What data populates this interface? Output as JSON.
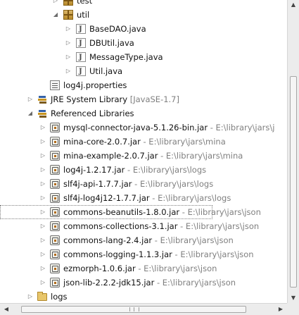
{
  "tree": {
    "test_pkg": "test",
    "util_pkg": "util",
    "files": [
      "BaseDAO.java",
      "DBUtil.java",
      "MessageType.java",
      "Util.java"
    ],
    "log4j": "log4j.properties",
    "jre": {
      "label": "JRE System Library",
      "version": "[JavaSE-1.7]"
    },
    "reflibs": "Referenced Libraries",
    "jars": [
      {
        "name": "mysql-connector-java-5.1.26-bin.jar",
        "path": " - E:\\library\\jars\\j"
      },
      {
        "name": "mina-core-2.0.7.jar",
        "path": " - E:\\library\\jars\\mina"
      },
      {
        "name": "mina-example-2.0.7.jar",
        "path": " - E:\\library\\jars\\mina"
      },
      {
        "name": "log4j-1.2.17.jar",
        "path": " - E:\\library\\jars\\logs"
      },
      {
        "name": "slf4j-api-1.7.7.jar",
        "path": " - E:\\library\\jars\\logs"
      },
      {
        "name": "slf4j-log4j12-1.7.7.jar",
        "path": " - E:\\library\\jars\\logs"
      },
      {
        "name": "commons-beanutils-1.8.0.jar",
        "path": " - E:\\library\\jars\\json"
      },
      {
        "name": "commons-collections-3.1.jar",
        "path": " - E:\\library\\jars\\json"
      },
      {
        "name": "commons-lang-2.4.jar",
        "path": " - E:\\library\\jars\\json"
      },
      {
        "name": "commons-logging-1.1.3.jar",
        "path": " - E:\\library\\jars\\json"
      },
      {
        "name": "ezmorph-1.0.6.jar",
        "path": " - E:\\library\\jars\\json"
      },
      {
        "name": "json-lib-2.2.2-jdk15.jar",
        "path": " - E:\\library\\jars\\json"
      }
    ],
    "logs": "logs"
  }
}
